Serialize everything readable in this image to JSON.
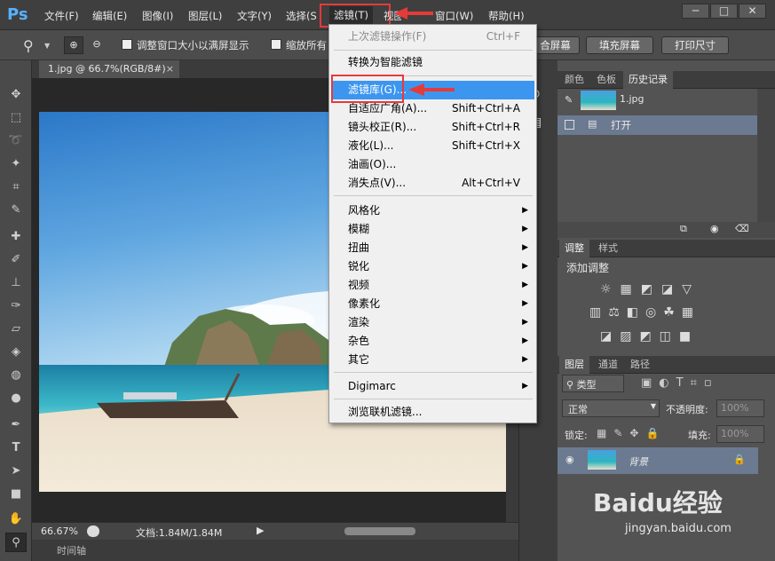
{
  "app": {
    "logo": "Ps"
  },
  "menubar": {
    "items": [
      "文件(F)",
      "编辑(E)",
      "图像(I)",
      "图层(L)",
      "文字(Y)",
      "选择(S)",
      "滤镜(T)",
      "视图(V)",
      "窗口(W)",
      "帮助(H)"
    ],
    "filter_item_partial_view": "视图",
    "select_item_partial": "选择(S",
    "window_buttons": [
      "─",
      "□",
      "✕"
    ]
  },
  "options_bar": {
    "checkbox1_label": "调整窗口大小以满屏显示",
    "checkbox2_label": "缩放所有",
    "buttons": [
      "合屏幕",
      "填充屏幕",
      "打印尺寸"
    ]
  },
  "document": {
    "tab_title": "1.jpg @ 66.7%(RGB/8#)",
    "tab_close": "×",
    "zoom": "66.67%",
    "doc_info": "文档:1.84M/1.84M",
    "timeline_label": "时间轴"
  },
  "filter_menu": {
    "items": [
      {
        "label": "上次滤镜操作(F)",
        "shortcut": "Ctrl+F",
        "disabled": true
      },
      {
        "label": "转换为智能滤镜",
        "shortcut": ""
      },
      {
        "label": "滤镜库(G)...",
        "shortcut": "",
        "highlighted": true
      },
      {
        "label": "自适应广角(A)...",
        "shortcut": "Shift+Ctrl+A"
      },
      {
        "label": "镜头校正(R)...",
        "shortcut": "Shift+Ctrl+R"
      },
      {
        "label": "液化(L)...",
        "shortcut": "Shift+Ctrl+X"
      },
      {
        "label": "油画(O)...",
        "shortcut": ""
      },
      {
        "label": "消失点(V)...",
        "shortcut": "Alt+Ctrl+V"
      },
      {
        "label": "风格化",
        "submenu": true
      },
      {
        "label": "模糊",
        "submenu": true
      },
      {
        "label": "扭曲",
        "submenu": true
      },
      {
        "label": "锐化",
        "submenu": true
      },
      {
        "label": "视频",
        "submenu": true
      },
      {
        "label": "像素化",
        "submenu": true
      },
      {
        "label": "渲染",
        "submenu": true
      },
      {
        "label": "杂色",
        "submenu": true
      },
      {
        "label": "其它",
        "submenu": true
      },
      {
        "label": "Digimarc",
        "submenu": true
      },
      {
        "label": "浏览联机滤镜..."
      }
    ]
  },
  "history_panel": {
    "tabs": [
      "颜色",
      "色板",
      "历史记录"
    ],
    "snapshot": "1.jpg",
    "entries": [
      "打开"
    ]
  },
  "adjust_panel": {
    "tabs": [
      "调整",
      "样式"
    ],
    "title": "添加调整"
  },
  "layers_panel": {
    "tabs": [
      "图层",
      "通道",
      "路径"
    ],
    "filter_kind": "类型",
    "blend_mode": "正常",
    "opacity_label": "不透明度:",
    "opacity_value": "100%",
    "lock_label": "锁定:",
    "fill_label": "填充:",
    "fill_value": "100%",
    "layer_name": "背景"
  },
  "watermark": {
    "brand": "Baidu经验",
    "url": "jingyan.baidu.com"
  },
  "colors": {
    "highlight": "#3c96f0",
    "annotation_red": "#e53a3a",
    "ps_blue": "#57b1ff"
  }
}
